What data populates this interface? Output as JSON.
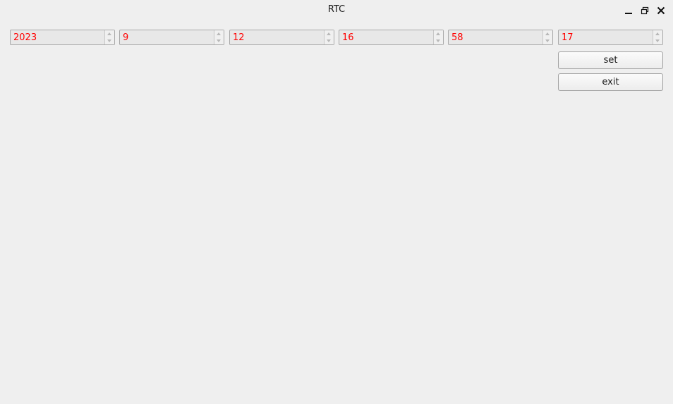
{
  "window": {
    "title": "RTC"
  },
  "titlebar_icons": [
    "minimize-icon",
    "maximize-icon",
    "close-icon"
  ],
  "spinboxes": [
    {
      "name": "year",
      "value": "2023"
    },
    {
      "name": "month",
      "value": "9"
    },
    {
      "name": "day",
      "value": "12"
    },
    {
      "name": "hour",
      "value": "16"
    },
    {
      "name": "minute",
      "value": "58"
    },
    {
      "name": "second",
      "value": "17"
    }
  ],
  "buttons": {
    "set_label": "set",
    "exit_label": "exit"
  },
  "colors": {
    "value_text": "#ff0000",
    "background": "#efefef"
  }
}
